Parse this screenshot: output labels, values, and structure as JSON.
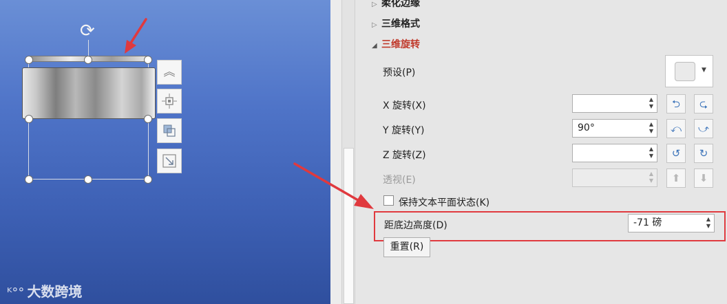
{
  "canvas": {
    "rotate_icon": "rotate-icon",
    "side_buttons": [
      "layout-options-icon",
      "align-icon",
      "arrange-icon",
      "resize-icon"
    ],
    "watermark_logo": "logo-icon",
    "watermark_text": "大数跨境"
  },
  "panel": {
    "sections": [
      {
        "label": "柔化边缘",
        "expanded": false
      },
      {
        "label": "三维格式",
        "expanded": false
      },
      {
        "label": "三维旋转",
        "expanded": true
      }
    ],
    "preset": {
      "label": "预设(P)"
    },
    "x_rotation": {
      "label": "X 旋转(X)",
      "value": "",
      "buttons": [
        "rotate-left-icon",
        "rotate-right-icon"
      ]
    },
    "y_rotation": {
      "label": "Y 旋转(Y)",
      "value": "90°",
      "buttons": [
        "rotate-up-icon",
        "rotate-down-icon"
      ]
    },
    "z_rotation": {
      "label": "Z 旋转(Z)",
      "value": "",
      "buttons": [
        "rotate-ccw-icon",
        "rotate-cw-icon"
      ]
    },
    "perspective": {
      "label": "透视(E)",
      "value": "",
      "disabled": true,
      "buttons": [
        "narrow-icon",
        "widen-icon"
      ]
    },
    "keep_text_flat": {
      "label": "保持文本平面状态(K)",
      "checked": false
    },
    "distance_from_ground": {
      "label": "距底边高度(D)",
      "value": "-71 磅"
    },
    "reset_label": "重置(R)"
  },
  "colors": {
    "accent_red": "#e0393e",
    "active_section": "#c0392b",
    "icon_blue": "#3b73b9"
  }
}
